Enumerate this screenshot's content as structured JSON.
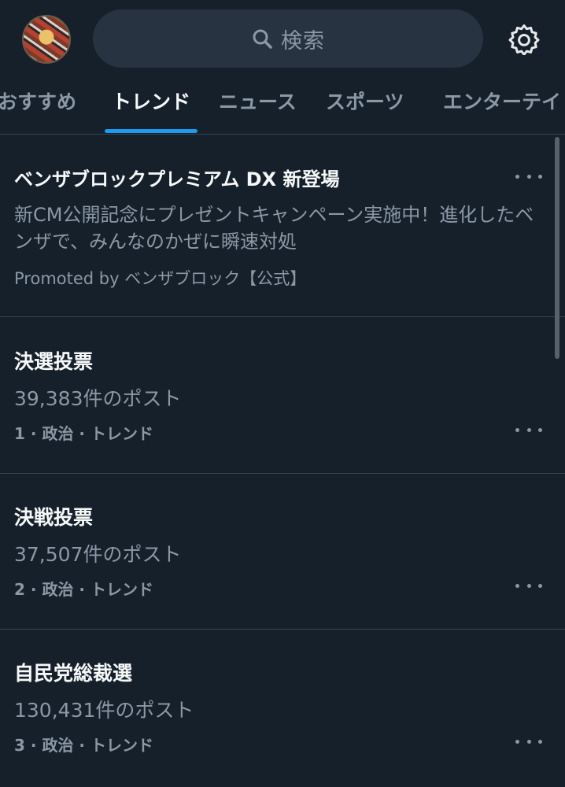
{
  "header": {
    "search_placeholder": "検索",
    "icons": {
      "avatar": "profile-avatar",
      "search": "search-icon",
      "settings": "gear-icon"
    }
  },
  "tabs": [
    {
      "label": "おすすめ",
      "active": false
    },
    {
      "label": "トレンド",
      "active": true
    },
    {
      "label": "ニュース",
      "active": false
    },
    {
      "label": "スポーツ",
      "active": false
    },
    {
      "label": "エンターテイ",
      "active": false
    }
  ],
  "promoted": {
    "title": "ベンザブロックプレミアム DX 新登場",
    "description": "新CM公開記念にプレゼントキャンペーン実施中！進化したベンザで、みんなのかぜに瞬速対処",
    "source": "Promoted by ベンザブロック【公式】"
  },
  "trends": [
    {
      "title": "決選投票",
      "count": "39,383件のポスト",
      "meta": "1 · 政治 · トレンド"
    },
    {
      "title": "決戦投票",
      "count": "37,507件のポスト",
      "meta": "2 · 政治 · トレンド"
    },
    {
      "title": "自民党総裁選",
      "count": "130,431件のポスト",
      "meta": "3 · 政治 · トレンド"
    }
  ],
  "colors": {
    "background": "#15202b",
    "accent": "#1d9bf0",
    "primary_text": "#f7f9f9",
    "secondary_text": "#8b98a5",
    "divider": "#38444d"
  }
}
